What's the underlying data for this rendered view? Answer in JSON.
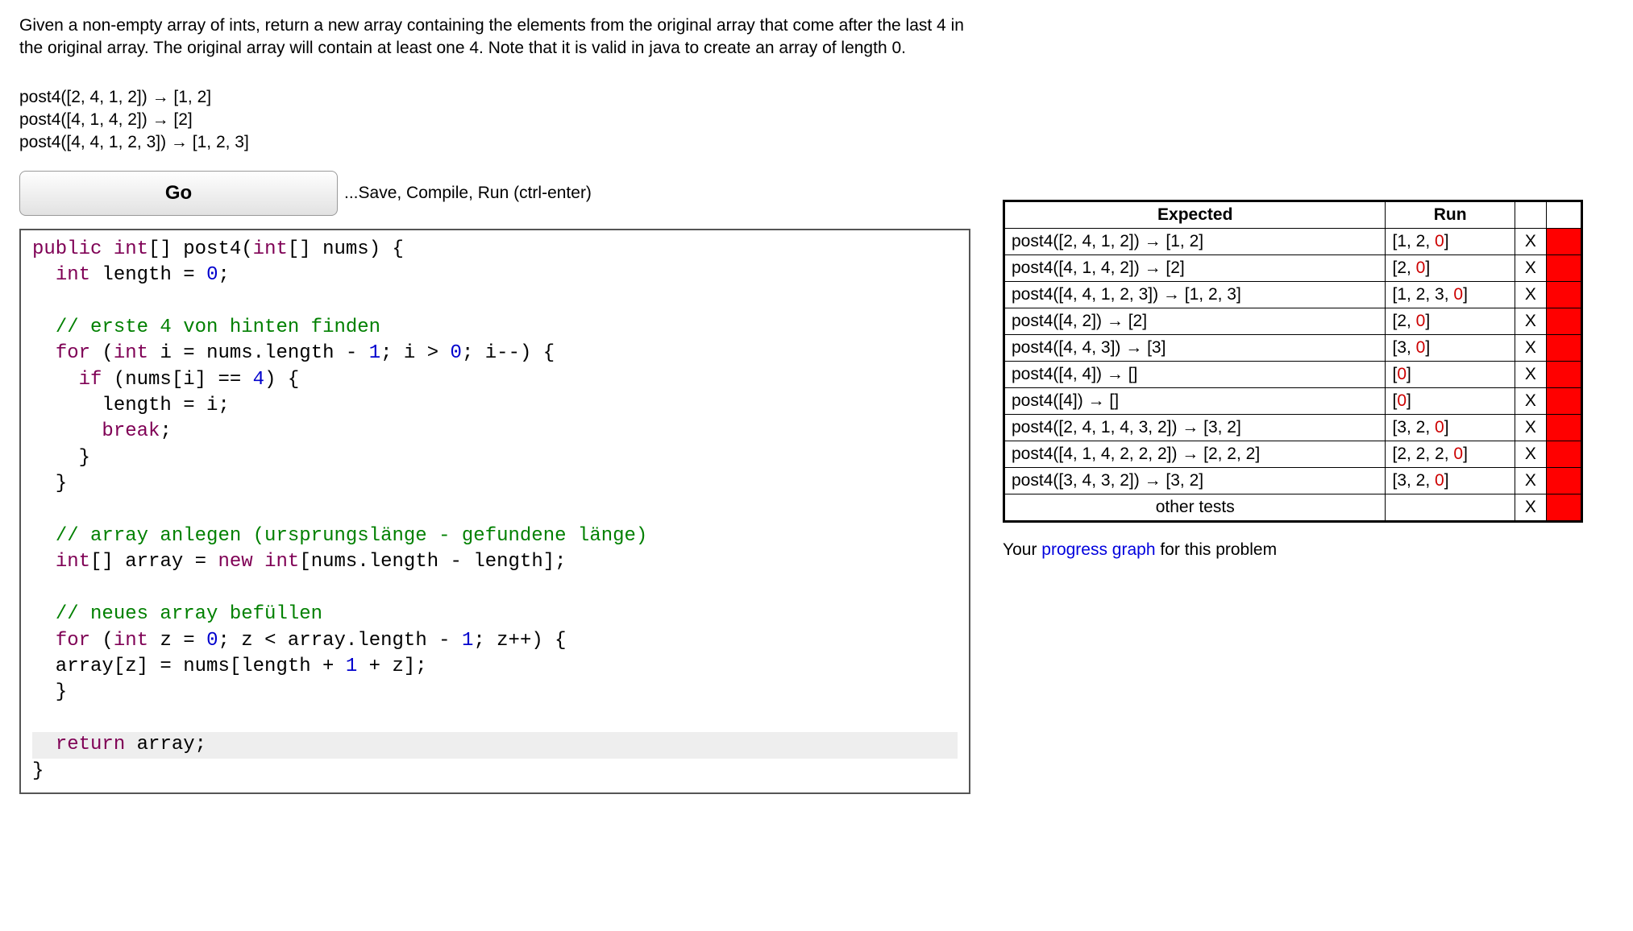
{
  "problem": {
    "description": "Given a non-empty array of ints, return a new array containing the elements from the original array that come after the last 4 in the original array. The original array will contain at least one 4. Note that it is valid in java to create an array of length 0.",
    "examples": [
      "post4([2, 4, 1, 2]) → [1, 2]",
      "post4([4, 1, 4, 2]) → [2]",
      "post4([4, 4, 1, 2, 3]) → [1, 2, 3]"
    ]
  },
  "controls": {
    "go_label": "Go",
    "go_hint": "...Save, Compile, Run (ctrl-enter)"
  },
  "code_tokens": [
    [
      [
        "kw",
        "public"
      ],
      [
        "p",
        " "
      ],
      [
        "kw",
        "int"
      ],
      [
        "p",
        "[] post4("
      ],
      [
        "kw",
        "int"
      ],
      [
        "p",
        "[] nums) {"
      ]
    ],
    [
      [
        "p",
        "  "
      ],
      [
        "kw",
        "int"
      ],
      [
        "p",
        " length = "
      ],
      [
        "num",
        "0"
      ],
      [
        "p",
        ";"
      ]
    ],
    [],
    [
      [
        "p",
        "  "
      ],
      [
        "com",
        "// erste 4 von hinten finden"
      ]
    ],
    [
      [
        "p",
        "  "
      ],
      [
        "kw",
        "for"
      ],
      [
        "p",
        " ("
      ],
      [
        "kw",
        "int"
      ],
      [
        "p",
        " i = nums.length - "
      ],
      [
        "num",
        "1"
      ],
      [
        "p",
        "; i > "
      ],
      [
        "num",
        "0"
      ],
      [
        "p",
        "; i--) {"
      ]
    ],
    [
      [
        "p",
        "    "
      ],
      [
        "kw",
        "if"
      ],
      [
        "p",
        " (nums[i] == "
      ],
      [
        "num",
        "4"
      ],
      [
        "p",
        ") {"
      ]
    ],
    [
      [
        "p",
        "      length = i;"
      ]
    ],
    [
      [
        "p",
        "      "
      ],
      [
        "kw",
        "break"
      ],
      [
        "p",
        ";"
      ]
    ],
    [
      [
        "p",
        "    }"
      ]
    ],
    [
      [
        "p",
        "  }"
      ]
    ],
    [],
    [
      [
        "p",
        "  "
      ],
      [
        "com",
        "// array anlegen (ursprungslänge - gefundene länge)"
      ]
    ],
    [
      [
        "p",
        "  "
      ],
      [
        "kw",
        "int"
      ],
      [
        "p",
        "[] array = "
      ],
      [
        "kw",
        "new"
      ],
      [
        "p",
        " "
      ],
      [
        "kw",
        "int"
      ],
      [
        "p",
        "[nums.length - length];"
      ]
    ],
    [],
    [
      [
        "p",
        "  "
      ],
      [
        "com",
        "// neues array befüllen"
      ]
    ],
    [
      [
        "p",
        "  "
      ],
      [
        "kw",
        "for"
      ],
      [
        "p",
        " ("
      ],
      [
        "kw",
        "int"
      ],
      [
        "p",
        " z = "
      ],
      [
        "num",
        "0"
      ],
      [
        "p",
        "; z < array.length - "
      ],
      [
        "num",
        "1"
      ],
      [
        "p",
        "; z++) {"
      ]
    ],
    [
      [
        "p",
        "  array[z] = nums[length + "
      ],
      [
        "num",
        "1"
      ],
      [
        "p",
        " + z];"
      ]
    ],
    [
      [
        "p",
        "  }"
      ]
    ],
    [],
    [
      [
        "hl-start",
        ""
      ],
      [
        "p",
        "  "
      ],
      [
        "kw",
        "return"
      ],
      [
        "p",
        " array;"
      ],
      [
        "hl-end",
        ""
      ]
    ],
    [
      [
        "p",
        "}"
      ]
    ]
  ],
  "results": {
    "headers": {
      "expected": "Expected",
      "run": "Run"
    },
    "rows": [
      {
        "expected": "post4([2, 4, 1, 2]) → [1, 2]",
        "run_prefix": "[1, 2, ",
        "run_trail": "0",
        "run_suffix": "]",
        "mark": "X",
        "pass": false
      },
      {
        "expected": "post4([4, 1, 4, 2]) → [2]",
        "run_prefix": "[2, ",
        "run_trail": "0",
        "run_suffix": "]",
        "mark": "X",
        "pass": false
      },
      {
        "expected": "post4([4, 4, 1, 2, 3]) → [1, 2, 3]",
        "run_prefix": "[1, 2, 3, ",
        "run_trail": "0",
        "run_suffix": "]",
        "mark": "X",
        "pass": false
      },
      {
        "expected": "post4([4, 2]) → [2]",
        "run_prefix": "[2, ",
        "run_trail": "0",
        "run_suffix": "]",
        "mark": "X",
        "pass": false
      },
      {
        "expected": "post4([4, 4, 3]) → [3]",
        "run_prefix": "[3, ",
        "run_trail": "0",
        "run_suffix": "]",
        "mark": "X",
        "pass": false
      },
      {
        "expected": "post4([4, 4]) → []",
        "run_prefix": "[",
        "run_trail": "0",
        "run_suffix": "]",
        "mark": "X",
        "pass": false
      },
      {
        "expected": "post4([4]) → []",
        "run_prefix": "[",
        "run_trail": "0",
        "run_suffix": "]",
        "mark": "X",
        "pass": false
      },
      {
        "expected": "post4([2, 4, 1, 4, 3, 2]) → [3, 2]",
        "run_prefix": "[3, 2, ",
        "run_trail": "0",
        "run_suffix": "]",
        "mark": "X",
        "pass": false
      },
      {
        "expected": "post4([4, 1, 4, 2, 2, 2]) → [2, 2, 2]",
        "run_prefix": "[2, 2, 2, ",
        "run_trail": "0",
        "run_suffix": "]",
        "mark": "X",
        "pass": false
      },
      {
        "expected": "post4([3, 4, 3, 2]) → [3, 2]",
        "run_prefix": "[3, 2, ",
        "run_trail": "0",
        "run_suffix": "]",
        "mark": "X",
        "pass": false
      }
    ],
    "other_tests_label": "other tests",
    "other_tests_mark": "X",
    "other_tests_pass": false
  },
  "progress": {
    "prefix": "Your ",
    "link": "progress graph",
    "suffix": " for this problem"
  }
}
